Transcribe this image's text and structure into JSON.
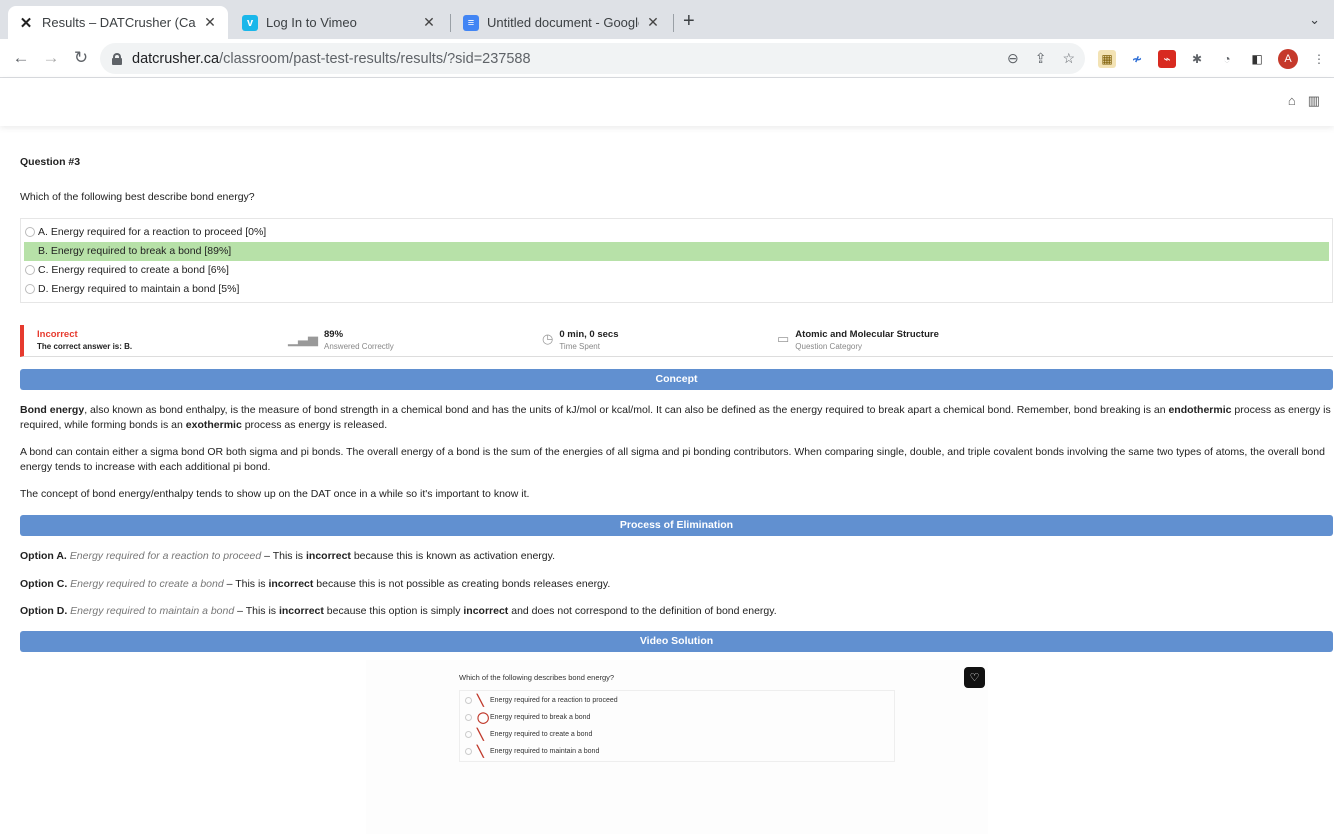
{
  "browser": {
    "tabs": [
      {
        "title": "Results – DATCrusher (Canadia",
        "active": true
      },
      {
        "title": "Log In to Vimeo",
        "active": false
      },
      {
        "title": "Untitled document - Google Do",
        "active": false
      }
    ],
    "url_host": "datcrusher.ca",
    "url_path": "/classroom/past-test-results/results/?sid=237588",
    "avatar_letter": "A"
  },
  "question": {
    "number_label": "Question #3",
    "text": "Which of the following best describe bond energy?",
    "options": [
      "A. Energy required for a reaction to proceed [0%]",
      "B. Energy required to break a bond [89%]",
      "C. Energy required to create a bond [6%]",
      "D. Energy required to maintain a bond [5%]"
    ]
  },
  "stats": {
    "status": "Incorrect",
    "correct_answer": "The correct answer is: B.",
    "percent": "89%",
    "percent_label": "Answered Correctly",
    "time": "0 min, 0 secs",
    "time_label": "Time Spent",
    "category": "Atomic and Molecular Structure",
    "category_label": "Question Category"
  },
  "sections": {
    "concept": "Concept",
    "elimination": "Process of Elimination",
    "video": "Video Solution"
  },
  "concept": {
    "p1_b1": "Bond energy",
    "p1_t1": ", also known as bond enthalpy, is the measure of bond strength in a chemical bond and has the units of kJ/mol or kcal/mol. It can also be defined as the energy required to break apart a chemical bond. Remember, bond breaking is an ",
    "p1_b2": "endothermic",
    "p1_t2": " process as energy is required, while forming bonds is an ",
    "p1_b3": "exothermic",
    "p1_t3": " process as energy is released.",
    "p2": "A bond can contain either a sigma bond OR both sigma and pi bonds. The overall energy of a bond is the sum of the energies of all sigma and pi bonding contributors. When comparing single, double, and triple covalent bonds involving the same two types of atoms, the overall bond energy tends to increase with each additional pi bond.",
    "p3": "The concept of bond energy/enthalpy tends to show up on the DAT once in a while so it's important to know it."
  },
  "elimination": [
    {
      "label": "Option A.",
      "option": "Energy required for a reaction to proceed",
      "t1": " – This is ",
      "b1": "incorrect",
      "t2": " because this is known as activation energy.",
      "b2": "",
      "t3": ""
    },
    {
      "label": "Option C.",
      "option": "Energy required to create a bond",
      "t1": " – This is ",
      "b1": "incorrect",
      "t2": " because this is not possible as creating bonds releases energy.",
      "b2": "",
      "t3": ""
    },
    {
      "label": "Option D.",
      "option": "Energy required to maintain a bond",
      "t1": " – This is ",
      "b1": "incorrect",
      "t2": " because this option is simply ",
      "b2": "incorrect",
      "t3": " and does not correspond to the definition of bond energy."
    }
  ],
  "video": {
    "question": "Which of the following describes bond energy?",
    "options": [
      "Energy required for a reaction to proceed",
      "Energy required to break a bond",
      "Energy required to create a bond",
      "Energy required to maintain a bond"
    ]
  }
}
